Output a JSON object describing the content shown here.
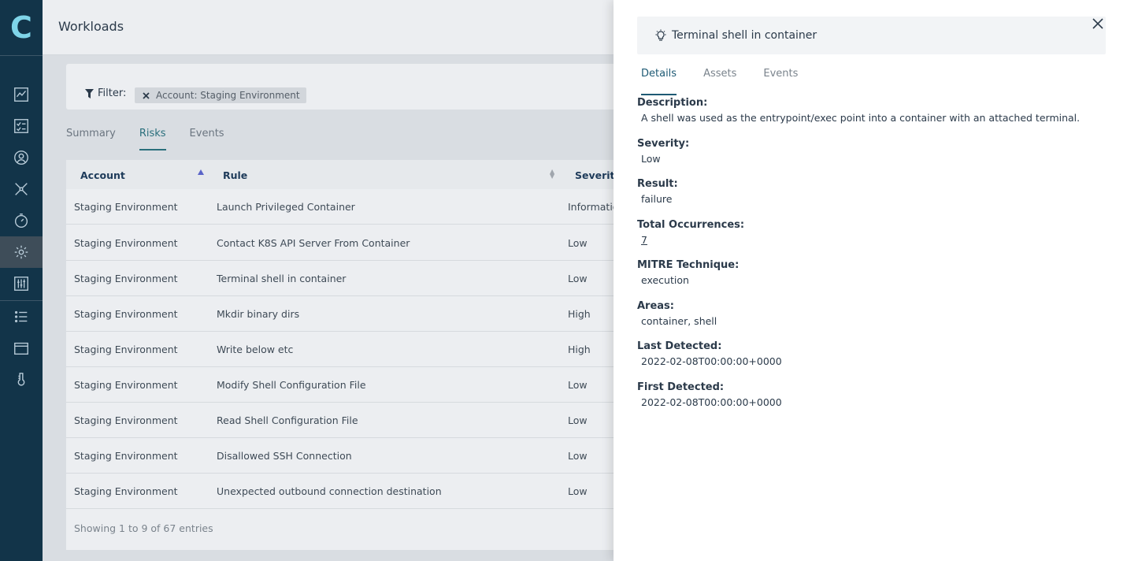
{
  "app": {
    "logo_letter": "C",
    "page_title": "Workloads"
  },
  "filter": {
    "label": "Filter:",
    "chip": "Account: Staging Environment"
  },
  "main_tabs": [
    {
      "label": "Summary"
    },
    {
      "label": "Risks"
    },
    {
      "label": "Events"
    }
  ],
  "table": {
    "columns": [
      "Account",
      "Rule",
      "Severity"
    ],
    "rows": [
      {
        "account": "Staging Environment",
        "rule": "Launch Privileged Container",
        "severity": "Informatio"
      },
      {
        "account": "Staging Environment",
        "rule": "Contact K8S API Server From Container",
        "severity": "Low"
      },
      {
        "account": "Staging Environment",
        "rule": "Terminal shell in container",
        "severity": "Low"
      },
      {
        "account": "Staging Environment",
        "rule": "Mkdir binary dirs",
        "severity": "High"
      },
      {
        "account": "Staging Environment",
        "rule": "Write below etc",
        "severity": "High"
      },
      {
        "account": "Staging Environment",
        "rule": "Modify Shell Configuration File",
        "severity": "Low"
      },
      {
        "account": "Staging Environment",
        "rule": "Read Shell Configuration File",
        "severity": "Low"
      },
      {
        "account": "Staging Environment",
        "rule": "Disallowed SSH Connection",
        "severity": "Low"
      },
      {
        "account": "Staging Environment",
        "rule": "Unexpected outbound connection destination",
        "severity": "Low"
      }
    ],
    "footer": "Showing 1 to 9 of 67 entries"
  },
  "panel": {
    "title": "Terminal shell in container",
    "tabs": [
      {
        "label": "Details"
      },
      {
        "label": "Assets"
      },
      {
        "label": "Events"
      }
    ],
    "fields": [
      {
        "label": "Description:",
        "value": "A shell was used as the entrypoint/exec point into a container with an attached terminal."
      },
      {
        "label": "Severity:",
        "value": "Low"
      },
      {
        "label": "Result:",
        "value": "failure"
      },
      {
        "label": "Total Occurrences:",
        "value": "7"
      },
      {
        "label": "MITRE Technique:",
        "value": "execution"
      },
      {
        "label": "Areas:",
        "value": "container, shell"
      },
      {
        "label": "Last Detected:",
        "value": "2022-02-08T00:00:00+0000"
      },
      {
        "label": "First Detected:",
        "value": "2022-02-08T00:00:00+0000"
      }
    ]
  },
  "colors": {
    "nav_bg": "#123449",
    "accent": "#2a6f7c",
    "panel_bg": "#ffffff"
  },
  "nav_icons": [
    "chart-icon",
    "checklist-icon",
    "user-icon",
    "network-icon",
    "stopwatch-icon",
    "workloads-icon",
    "sliders-icon",
    "list-icon",
    "window-icon",
    "integration-icon"
  ]
}
